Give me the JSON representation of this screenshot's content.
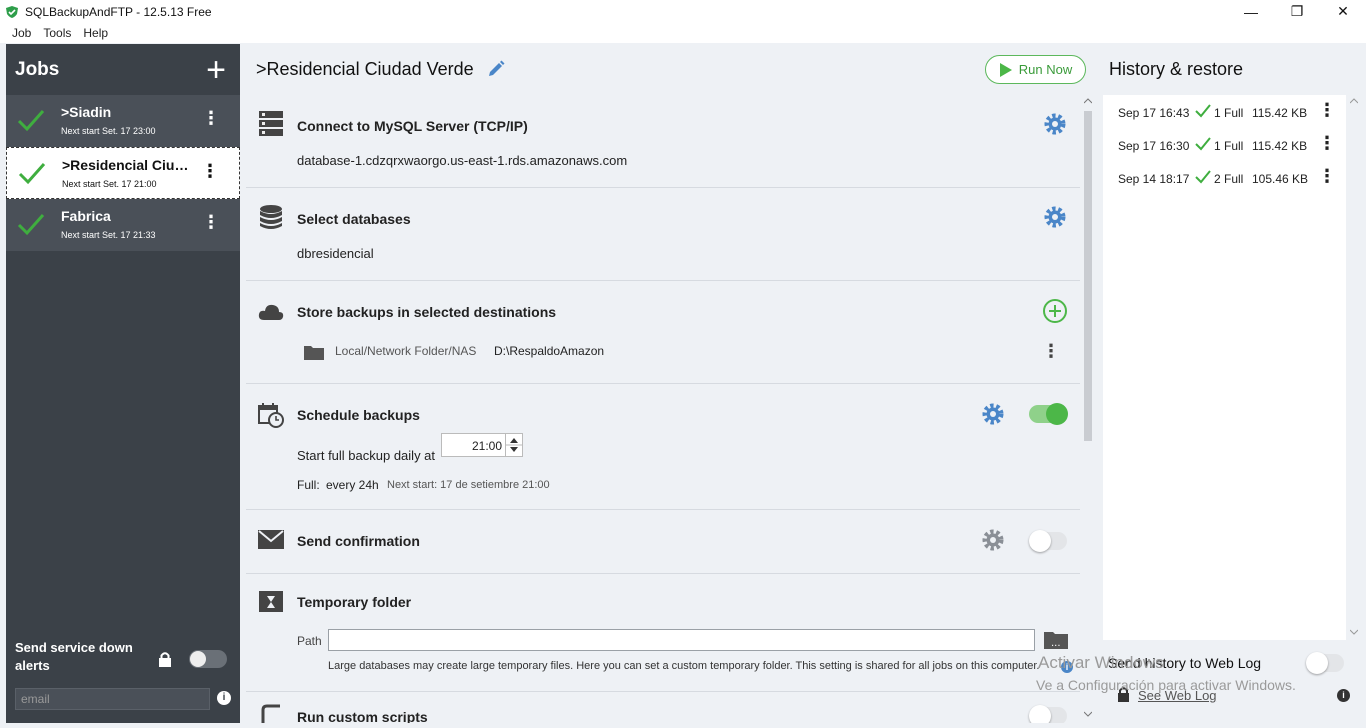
{
  "window": {
    "title": "SQLBackupAndFTP - 12.5.13 Free"
  },
  "menu": [
    "Job",
    "Tools",
    "Help"
  ],
  "jobs": {
    "header": "Jobs",
    "items": [
      {
        "name": ">Siadin",
        "next_start": "Next start Set. 17 23:00",
        "selected": false
      },
      {
        "name": ">Residencial Ciud...",
        "next_start": "Next start Set. 17 21:00",
        "selected": true
      },
      {
        "name": "Fabrica",
        "next_start": "Next start Set. 17 21:33",
        "selected": false
      }
    ],
    "service_alert_label": "Send service down alerts",
    "email_placeholder": "email"
  },
  "main": {
    "job_title": ">Residencial Ciudad Verde",
    "run_label": "Run Now",
    "sections": {
      "connect": {
        "title": "Connect to MySQL Server (TCP/IP)",
        "value": "database-1.cdzqrxwaorgo.us-east-1.rds.amazonaws.com"
      },
      "databases": {
        "title": "Select databases",
        "value": "dbresidencial"
      },
      "store": {
        "title": "Store backups in selected destinations",
        "dest_type": "Local/Network Folder/NAS",
        "dest_path": "D:\\RespaldoAmazon"
      },
      "schedule": {
        "title": "Schedule backups",
        "start_label": "Start full backup daily at",
        "time": "21:00",
        "full_label": "Full:",
        "full_value": "every 24h",
        "next_start": "Next start: 17 de setiembre 21:00",
        "enabled": true
      },
      "confirmation": {
        "title": "Send confirmation",
        "enabled": false
      },
      "temp": {
        "title": "Temporary folder",
        "path_label": "Path",
        "note": "Large databases may create large temporary files. Here you can set a custom temporary folder. This setting is shared for all jobs on this computer."
      },
      "scripts": {
        "title": "Run custom scripts"
      }
    }
  },
  "history": {
    "header": "History & restore",
    "rows": [
      {
        "date": "Sep 17 16:43",
        "type": "1 Full",
        "size": "115.42 KB"
      },
      {
        "date": "Sep 17 16:30",
        "type": "1 Full",
        "size": "115.42 KB"
      },
      {
        "date": "Sep 14 18:17",
        "type": "2 Full",
        "size": "105.46 KB"
      }
    ],
    "weblog_label": "Send history to Web Log",
    "see_weblog": "See Web Log"
  },
  "watermark": {
    "line1": "Activar Windows",
    "line2": "Ve a Configuración para activar Windows."
  },
  "colors": {
    "accent_blue": "#4a86c8",
    "green": "#4cb748",
    "sidebar": "#3b4148"
  }
}
